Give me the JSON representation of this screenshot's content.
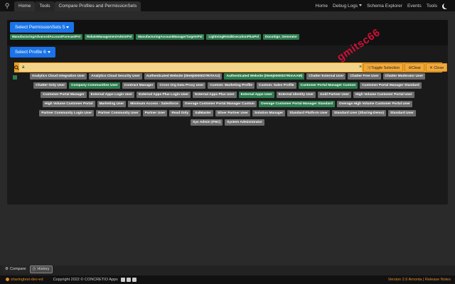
{
  "nav": {
    "tabs": [
      "Home",
      "Tools",
      "Compare Profiles and PermissionSets"
    ],
    "right": [
      "Home",
      "Debug Logs",
      "Schema Explorer",
      "Events",
      "Tools"
    ]
  },
  "permsets": {
    "button_label": "Select PermissionSets 5",
    "selected": [
      "ManufacturingAdvancedAccountForecastPsl",
      "RebateManagementAdminPsl",
      "ManufacturingAccountManagerTargetsPsl",
      "LightningRetailExecutionPlusPsl",
      "DocuSign_Generator"
    ]
  },
  "profiles": {
    "button_label": "Select Profile 6",
    "search_value": "a",
    "clear_x": "×",
    "toggle_label": "Toggle Selection",
    "clear_label": "Clear",
    "close_label": "Close",
    "rows": [
      [
        {
          "t": "Analytics Cloud Integration User",
          "s": false
        },
        {
          "t": "Analytics Cloud Security User",
          "s": false
        },
        {
          "t": "Authenticated Website (00e5j0000027RITAA2)",
          "s": false
        },
        {
          "t": "Authenticated Website (00e5j0000027RimAAM)",
          "s": true
        },
        {
          "t": "Chatter External User",
          "s": false
        },
        {
          "t": "Chatter Free User",
          "s": false
        },
        {
          "t": "Chatter Moderator User",
          "s": false
        }
      ],
      [
        {
          "t": "Chatter Only User",
          "s": false
        },
        {
          "t": "Company Communities User",
          "s": true
        },
        {
          "t": "Contract Manager",
          "s": false
        },
        {
          "t": "Cross Org Data Proxy User",
          "s": false
        },
        {
          "t": "Custom: Marketing Profile",
          "s": false
        },
        {
          "t": "Custom: Sales Profile",
          "s": false
        },
        {
          "t": "Customer Portal Manager Custom",
          "s": true
        },
        {
          "t": "Customer Portal Manager Standard",
          "s": false
        }
      ],
      [
        {
          "t": "Customer Portal Manager",
          "s": false
        },
        {
          "t": "External Apps Login User",
          "s": false
        },
        {
          "t": "External Apps Plus Login User",
          "s": false
        },
        {
          "t": "External Apps Plus User",
          "s": false
        },
        {
          "t": "External Apps User",
          "s": true
        },
        {
          "t": "External Identity User",
          "s": false
        },
        {
          "t": "Gold Partner User",
          "s": false
        },
        {
          "t": "High Volume Customer Portal User",
          "s": false
        }
      ],
      [
        {
          "t": "High Volume Customer Portal",
          "s": false
        },
        {
          "t": "Marketing User",
          "s": false
        },
        {
          "t": "Minimum Access - Salesforce",
          "s": false
        },
        {
          "t": "Overage Customer Portal Manager Custom",
          "s": false
        },
        {
          "t": "Overage Customer Portal Manager Standard",
          "s": true
        },
        {
          "t": "Overage High Volume Customer Portal User",
          "s": false
        }
      ],
      [
        {
          "t": "Partner Community Login User",
          "s": false
        },
        {
          "t": "Partner Community User",
          "s": false
        },
        {
          "t": "Partner User",
          "s": false
        },
        {
          "t": "Read Only",
          "s": false
        },
        {
          "t": "SalMaster",
          "s": false
        },
        {
          "t": "Silver Partner User",
          "s": false
        },
        {
          "t": "Solution Manager",
          "s": false
        },
        {
          "t": "Standard Platform User",
          "s": false
        },
        {
          "t": "Standard User (Sharing-Demo)",
          "s": false
        },
        {
          "t": "Standard User",
          "s": false
        }
      ],
      [
        {
          "t": "Sys Admin (FNC)",
          "s": false
        },
        {
          "t": "System Administrator",
          "s": false
        }
      ]
    ]
  },
  "watermark": "gmitsc66",
  "bottom_tabs": [
    "Compare",
    "History"
  ],
  "footer": {
    "user": "sharingtest-dev-ed",
    "copyright": "Copyright 2022 © CONCRETIO Apps",
    "version": "Version 2.6 Amonta | Release Notes"
  },
  "colors": {
    "accent_blue": "#1a73e8",
    "selected_green": "#2e7d4f",
    "search_orange": "#f0a020",
    "watermark_red": "#e0103a"
  }
}
